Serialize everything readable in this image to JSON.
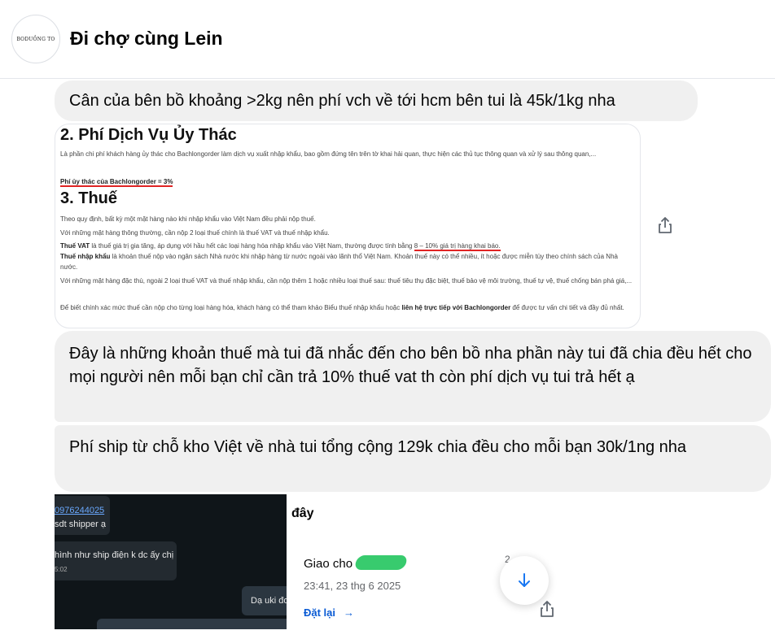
{
  "header": {
    "title": "Đi chợ cùng Lein",
    "avatar_text": "BODUỒNG TO"
  },
  "messages": [
    {
      "text": "Cân của bên bồ khoảng >2kg nên phí vch về tới hcm bên tui là 45k/1kg nha"
    },
    {
      "text": "Đây là những khoản thuế mà tui đã nhắc đến cho bên bồ nha phần này tui đã chia đều hết cho mọi người nên mỗi bạn chỉ cần trả 10% thuế vat th còn phí dịch vụ tui trả hết ạ"
    },
    {
      "text": "Phí ship từ chỗ kho Việt về nhà tui tổng cộng 129k chia đều cho mỗi bạn 30k/1ng nha"
    }
  ],
  "doc_image": {
    "heading2": "2. Phí Dịch Vụ Ủy Thác",
    "para1": "Là phần chi phí khách hàng ủy thác cho Bachlongorder làm dịch vụ xuất nhập khẩu, bao gồm đứng tên trên tờ khai hải quan, thực hiện các thủ tục thông quan và xử lý sau thông quan,...",
    "fee_line": "Phí ủy thác của Bachlongorder = 3%",
    "heading3": "3. Thuế",
    "para2": "Theo quy định, bất kỳ một mặt hàng nào khi nhập khẩu vào Việt Nam đều phải nộp thuế.",
    "para3": "Với những mặt hàng thông thường, cần nộp 2 loại thuế chính là thuế VAT và thuế nhập khẩu.",
    "vat_bold": "Thuế VAT",
    "vat_text": " là thuế giá trị gia tăng, áp dụng với hầu hết các loại hàng hóa nhập khẩu vào Việt Nam, thường được tính bằng ",
    "vat_rate": "8 – 10% giá trị hàng khai báo.",
    "import_bold": "Thuế nhập khẩu",
    "import_text": " là khoản thuế nộp vào ngân sách Nhà nước khi nhập hàng từ nước ngoài vào lãnh thổ Việt Nam. Khoản thuế này có thể nhiều, ít hoặc được miễn tùy theo chính sách của Nhà nước.",
    "para5": "Với những mặt hàng đặc thù, ngoài 2 loại thuế VAT và thuế nhập khẩu, cần nộp thêm 1 hoặc nhiều loại thuế sau: thuế tiêu thụ đặc biệt, thuế bảo vệ môi trường, thuế tự vệ, thuế chống bán phá giá,...",
    "para6_a": "Để biết chính xác mức thuế cần nộp cho từng loại hàng hóa, khách hàng có thể tham khảo Biểu thuế nhập khẩu hoặc ",
    "para6_bold": "liên hệ trực tiếp với Bachlongorder",
    "para6_b": " để được tư vấn chi tiết và đầy đủ nhất."
  },
  "photo": {
    "phone": "0976244025",
    "msg1": "sdt shipper ạ",
    "msg2": "hình như ship điện k dc ấy chị",
    "time": "5:02",
    "msg3": "Dạ uki đơ"
  },
  "side": {
    "caption": "đây",
    "status": "Giao cho",
    "timestamp": "23:41, 23 thg 6 2025",
    "retry": "Đặt lại",
    "dot": "2"
  },
  "icons": {
    "share": "share-icon",
    "scroll": "arrow-down-icon"
  }
}
